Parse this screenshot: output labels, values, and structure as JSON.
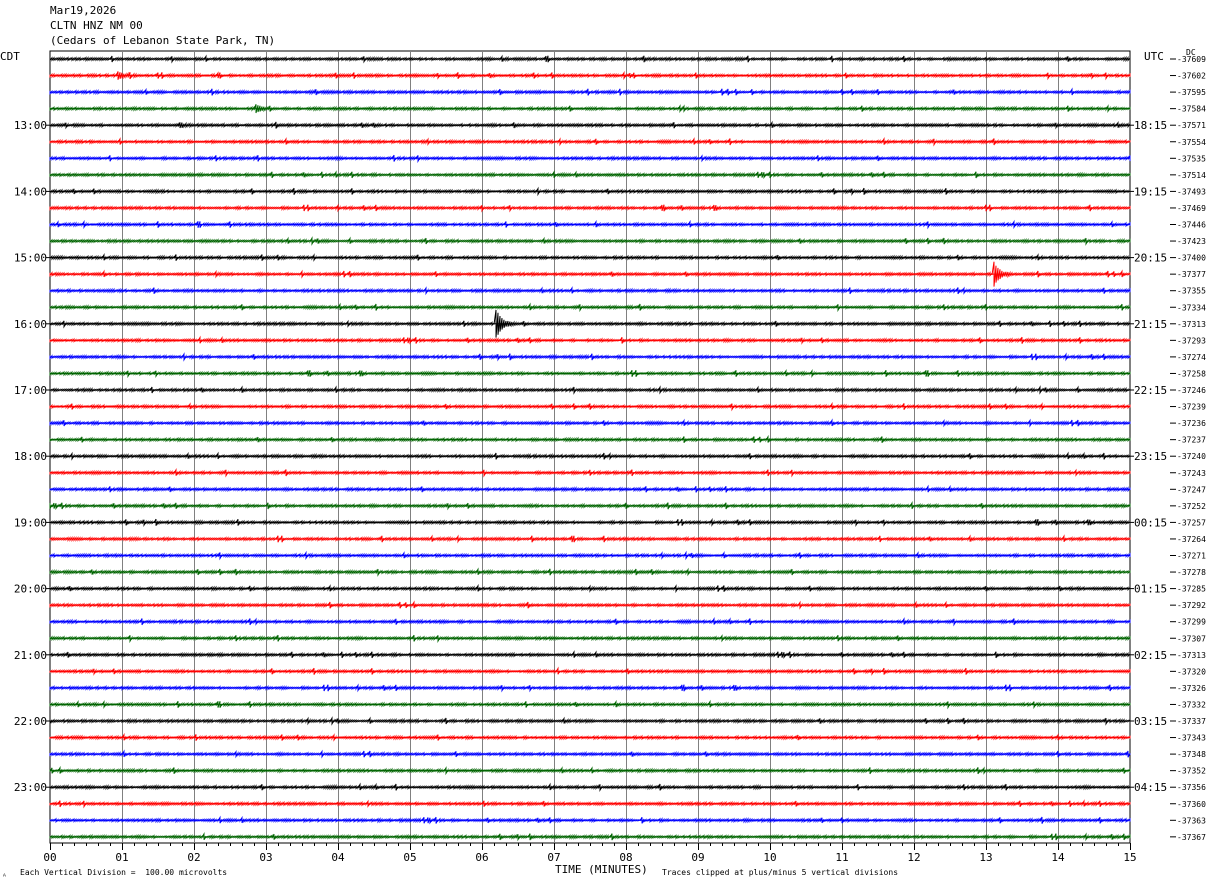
{
  "header": {
    "date": "Mar19,2026",
    "station": "CLTN HNZ NM 00",
    "location": "(Cedars of Lebanon State Park, TN)"
  },
  "left_axis_label": "CDT",
  "right_axis_label": "UTC",
  "dc_label": "DC",
  "footer": {
    "scale_note": "Each Vertical Division =  100.00 microvolts",
    "clip_note": "Traces clipped at plus/minus 5 vertical divisions",
    "corner_mark": "ᴬ"
  },
  "colors": {
    "trace_cycle": [
      "#000000",
      "#ff0000",
      "#0000ff",
      "#006400"
    ],
    "grid": "#808080"
  },
  "chart_data": {
    "type": "line",
    "title": "",
    "xlabel": "TIME (MINUTES)",
    "xlim": [
      0,
      15
    ],
    "x_ticks": [
      "00",
      "01",
      "02",
      "03",
      "04",
      "05",
      "06",
      "07",
      "08",
      "09",
      "10",
      "11",
      "12",
      "13",
      "14",
      "15"
    ],
    "num_traces": 48,
    "left_time_labels": [
      {
        "trace": 4,
        "label": "13:00"
      },
      {
        "trace": 8,
        "label": "14:00"
      },
      {
        "trace": 12,
        "label": "15:00"
      },
      {
        "trace": 16,
        "label": "16:00"
      },
      {
        "trace": 20,
        "label": "17:00"
      },
      {
        "trace": 24,
        "label": "18:00"
      },
      {
        "trace": 28,
        "label": "19:00"
      },
      {
        "trace": 32,
        "label": "20:00"
      },
      {
        "trace": 36,
        "label": "21:00"
      },
      {
        "trace": 40,
        "label": "22:00"
      },
      {
        "trace": 44,
        "label": "23:00"
      }
    ],
    "right_time_labels": [
      {
        "trace": 4,
        "label": "18:15"
      },
      {
        "trace": 8,
        "label": "19:15"
      },
      {
        "trace": 12,
        "label": "20:15"
      },
      {
        "trace": 16,
        "label": "21:15"
      },
      {
        "trace": 20,
        "label": "22:15"
      },
      {
        "trace": 24,
        "label": "23:15"
      },
      {
        "trace": 28,
        "label": "00:15"
      },
      {
        "trace": 32,
        "label": "01:15"
      },
      {
        "trace": 36,
        "label": "02:15"
      },
      {
        "trace": 40,
        "label": "03:15"
      },
      {
        "trace": 44,
        "label": "04:15"
      }
    ],
    "dc_offsets": [
      "-37609",
      "-37602",
      "-37595",
      "-37584",
      "-37571",
      "-37554",
      "-37535",
      "-37514",
      "-37493",
      "-37469",
      "-37446",
      "-37423",
      "-37400",
      "-37377",
      "-37355",
      "-37334",
      "-37313",
      "-37293",
      "-37274",
      "-37258",
      "-37246",
      "-37239",
      "-37236",
      "-37237",
      "-37240",
      "-37243",
      "-37247",
      "-37252",
      "-37257",
      "-37264",
      "-37271",
      "-37278",
      "-37285",
      "-37292",
      "-37299",
      "-37307",
      "-37313",
      "-37320",
      "-37326",
      "-37332",
      "-37337",
      "-37343",
      "-37348",
      "-37352",
      "-37356",
      "-37360",
      "-37363",
      "-37367"
    ],
    "events": [
      {
        "trace": 1,
        "minute": 0.95,
        "amplitude": 0.35
      },
      {
        "trace": 3,
        "minute": 2.85,
        "amplitude": 0.35
      },
      {
        "trace": 4,
        "minute": 1.8,
        "amplitude": 0.2
      },
      {
        "trace": 13,
        "minute": 13.1,
        "amplitude": 1.3
      },
      {
        "trace": 16,
        "minute": 6.2,
        "amplitude": 1.3
      }
    ]
  }
}
